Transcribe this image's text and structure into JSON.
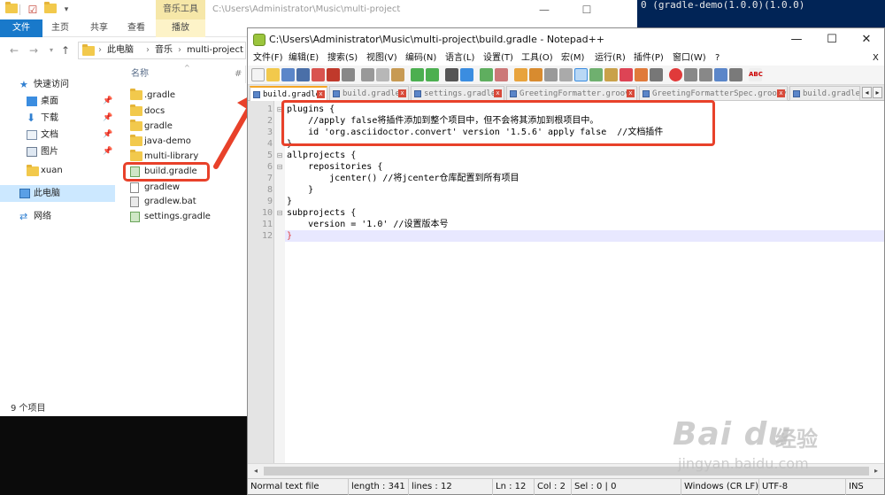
{
  "terminal": {
    "text": "0 (gradle-demo(1.0.0)(1.0.0)"
  },
  "explorer": {
    "context_tab": "音乐工具",
    "title": "C:\\Users\\Administrator\\Music\\multi-project",
    "ribbon_tabs": [
      "文件",
      "主页",
      "共享",
      "查看",
      "播放"
    ],
    "breadcrumb": [
      "此电脑",
      "音乐",
      "multi-project"
    ],
    "column_header": "名称",
    "nav": [
      {
        "label": "快速访问",
        "icon": "star-icon"
      },
      {
        "label": "桌面",
        "icon": "desktop-icon"
      },
      {
        "label": "下载",
        "icon": "download-icon"
      },
      {
        "label": "文档",
        "icon": "document-icon"
      },
      {
        "label": "图片",
        "icon": "pictures-icon"
      },
      {
        "label": "xuan",
        "icon": "folder-icon"
      },
      {
        "label": "此电脑",
        "icon": "computer-icon"
      },
      {
        "label": "网络",
        "icon": "network-icon"
      }
    ],
    "files": [
      {
        "name": ".gradle",
        "type": "folder"
      },
      {
        "name": "docs",
        "type": "folder"
      },
      {
        "name": "gradle",
        "type": "folder"
      },
      {
        "name": "java-demo",
        "type": "folder"
      },
      {
        "name": "multi-library",
        "type": "folder"
      },
      {
        "name": "build.gradle",
        "type": "gradle"
      },
      {
        "name": "gradlew",
        "type": "doc"
      },
      {
        "name": "gradlew.bat",
        "type": "doc"
      },
      {
        "name": "settings.gradle",
        "type": "gradle"
      }
    ],
    "status": "9 个项目",
    "col_hash": "#"
  },
  "npp": {
    "title": "C:\\Users\\Administrator\\Music\\multi-project\\build.gradle - Notepad++",
    "menu": [
      "文件(F)",
      "编辑(E)",
      "搜索(S)",
      "视图(V)",
      "编码(N)",
      "语言(L)",
      "设置(T)",
      "工具(O)",
      "宏(M)",
      "运行(R)",
      "插件(P)",
      "窗口(W)",
      "?"
    ],
    "menu_close": "X",
    "tabs": [
      "build.gradle",
      "build.gradle",
      "settings.gradle",
      "GreetingFormatter.groovy",
      "GreetingFormatterSpec.groovy",
      "build.gradle"
    ],
    "lines": [
      "plugins {",
      "    //apply false将插件添加到整个项目中，但不会将其添加到根项目中。",
      "    id 'org.asciidoctor.convert' version '1.5.6' apply false  //文档插件",
      "}",
      "allprojects {",
      "    repositories {",
      "        jcenter() //将jcenter仓库配置到所有项目",
      "    }",
      "}",
      "subprojects {",
      "    version = '1.0' //设置版本号",
      "}"
    ],
    "status": {
      "type": "Normal text file",
      "length": "length : 341",
      "lines": "lines : 12",
      "ln": "Ln : 12",
      "col": "Col : 2",
      "sel": "Sel : 0 | 0",
      "eol": "Windows (CR LF)",
      "enc": "UTF-8",
      "ins": "INS"
    }
  },
  "watermark": {
    "brand": "Bai du",
    "jingyan": "经验",
    "url": "jingyan.baidu.com"
  },
  "colors": {
    "highlight": "#e8412a",
    "file_tab": "#1979ca",
    "context_tab": "#f6e7a8",
    "terminal_bg": "#012456"
  }
}
